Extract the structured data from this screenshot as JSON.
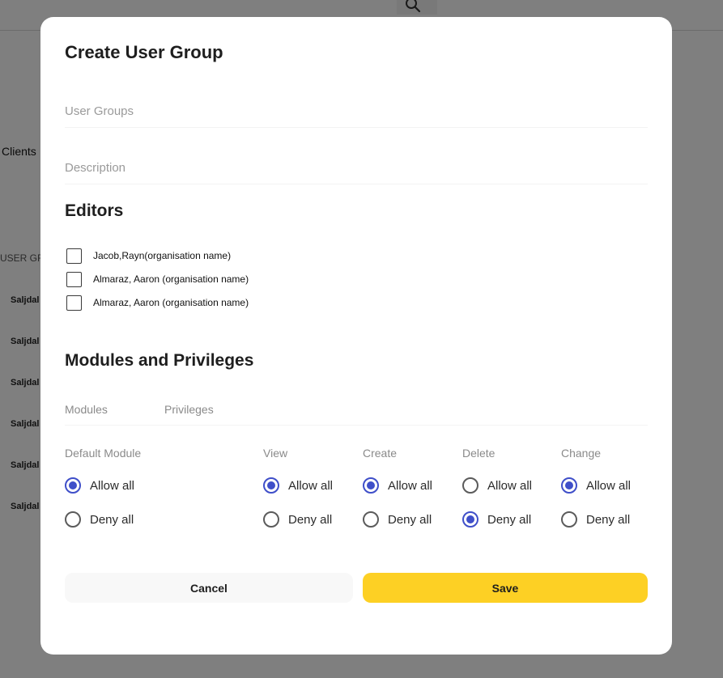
{
  "background": {
    "clients_label": "Clients",
    "user_groups_label": "USER GR",
    "rows": [
      "Saljdal",
      "Saljdal",
      "Saljdal",
      "Saljdal",
      "Saljdal",
      "Saljdal"
    ]
  },
  "modal": {
    "title": "Create User Group",
    "user_groups_placeholder": "User Groups",
    "description_placeholder": "Description",
    "editors_title": "Editors",
    "editors": [
      {
        "label": "Jacob,Rayn(organisation name)",
        "checked": false
      },
      {
        "label": "Almaraz, Aaron (organisation name)",
        "checked": false
      },
      {
        "label": "Almaraz, Aaron (organisation name)",
        "checked": false
      }
    ],
    "modules_title": "Modules and Privileges",
    "tabs": {
      "modules": "Modules",
      "privileges": "Privileges"
    },
    "columns": {
      "default_module": "Default Module",
      "view": "View",
      "create": "Create",
      "delete": "Delete",
      "change": "Change"
    },
    "options": {
      "allow": "Allow all",
      "deny": "Deny all"
    },
    "selections": {
      "default_module": "allow",
      "view": "allow",
      "create": "allow",
      "delete": "deny",
      "change": "allow"
    },
    "cancel_label": "Cancel",
    "save_label": "Save"
  },
  "colors": {
    "accent": "#3f4fc9",
    "save_button": "#fdd024",
    "overlay": "rgba(0,0,0,0.5)"
  },
  "icons": {
    "search": "search-icon"
  }
}
